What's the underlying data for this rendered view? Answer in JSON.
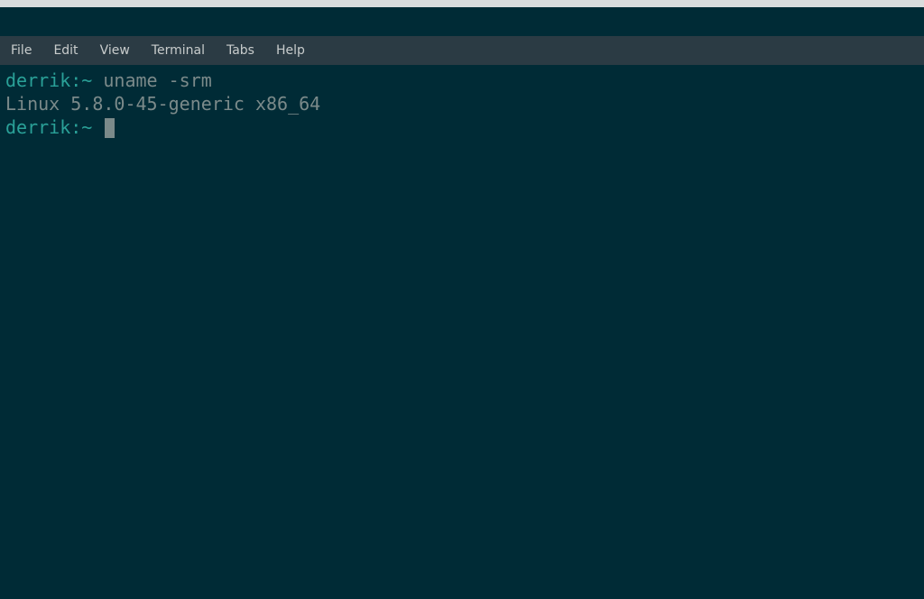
{
  "menubar": {
    "items": [
      {
        "label": "File"
      },
      {
        "label": "Edit"
      },
      {
        "label": "View"
      },
      {
        "label": "Terminal"
      },
      {
        "label": "Tabs"
      },
      {
        "label": "Help"
      }
    ]
  },
  "terminal": {
    "line1_prompt": "derrik:~",
    "line1_command": " uname -srm",
    "line2_output": "Linux 5.8.0-45-generic x86_64",
    "line3_prompt": "derrik:~ "
  }
}
